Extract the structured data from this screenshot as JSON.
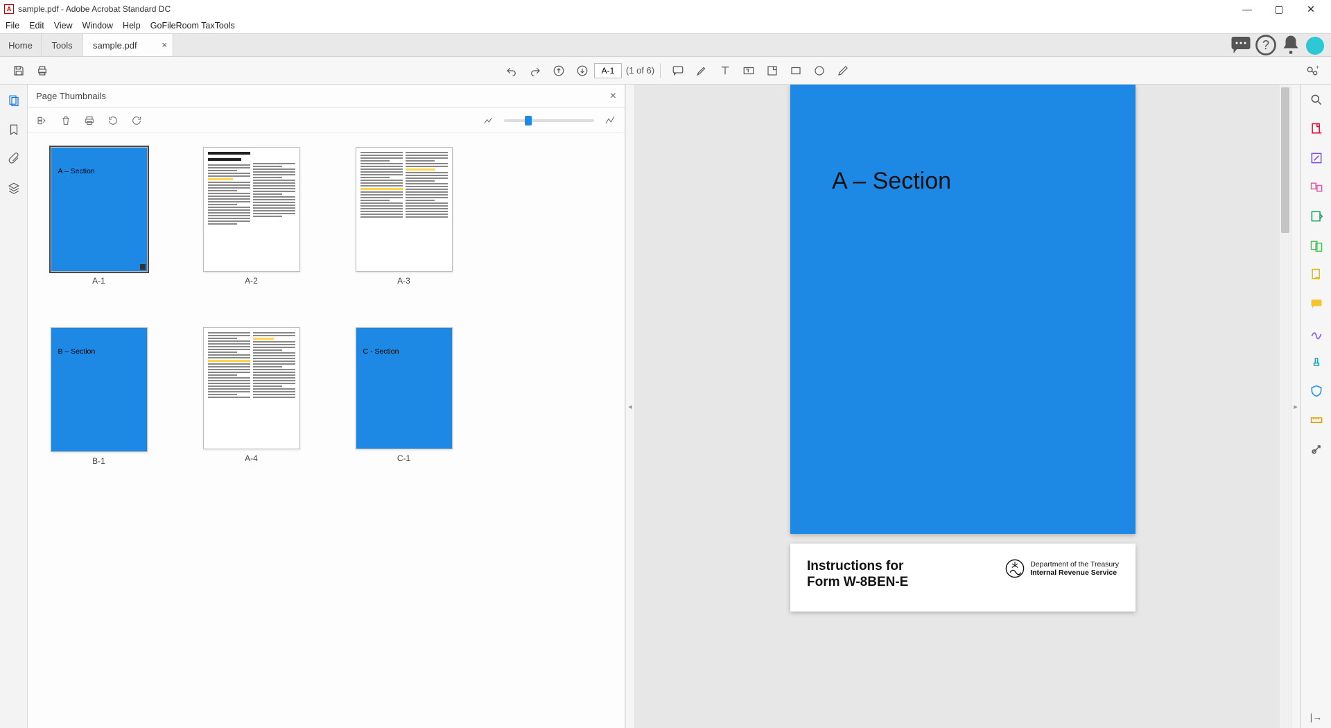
{
  "titlebar": {
    "app_icon": "A",
    "title": "sample.pdf - Adobe Acrobat Standard DC"
  },
  "window_controls": {
    "minimize": "—",
    "maximize": "▢",
    "close": "✕"
  },
  "menubar": [
    "File",
    "Edit",
    "View",
    "Window",
    "Help",
    "GoFileRoom TaxTools"
  ],
  "tabs": {
    "home": "Home",
    "tools": "Tools",
    "doc": "sample.pdf",
    "doc_close": "×"
  },
  "toolbar": {
    "current_page": "A-1",
    "page_count": "(1 of 6)"
  },
  "thumbnails": {
    "title": "Page Thumbnails",
    "close": "×",
    "items": [
      {
        "label": "A-1",
        "kind": "section",
        "text": "A – Section",
        "selected": true
      },
      {
        "label": "A-2",
        "kind": "doc-header"
      },
      {
        "label": "A-3",
        "kind": "doc"
      },
      {
        "label": "B-1",
        "kind": "section",
        "text": "B – Section"
      },
      {
        "label": "A-4",
        "kind": "doc"
      },
      {
        "label": "C-1",
        "kind": "section",
        "text": "C - Section"
      }
    ]
  },
  "mainpage": {
    "section_title": "A – Section",
    "form_title_l1": "Instructions for",
    "form_title_l2": "Form W-8BEN-E",
    "dept_l1": "Department of the Treasury",
    "dept_l2": "Internal Revenue Service"
  }
}
